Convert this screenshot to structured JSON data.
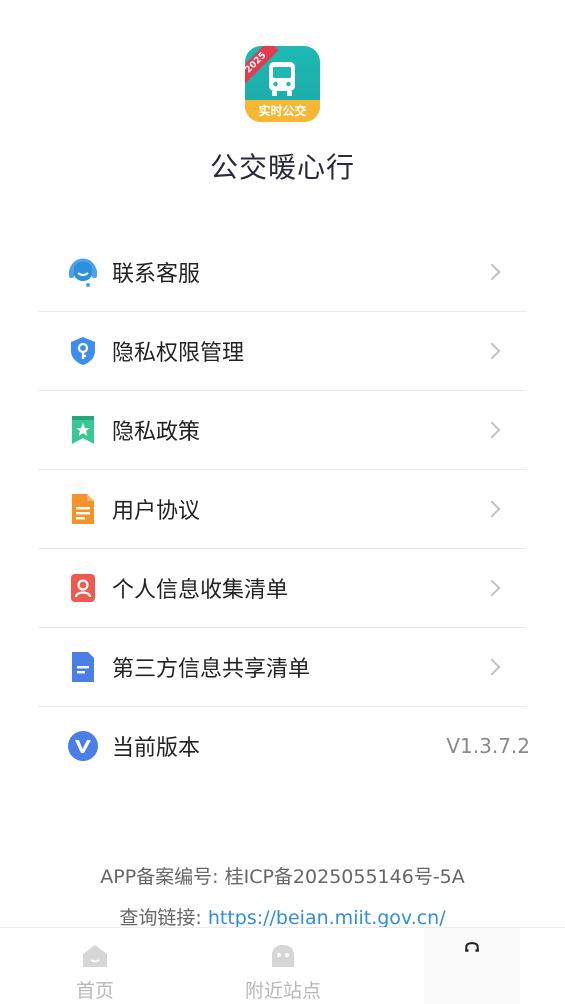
{
  "app": {
    "badge_year": "2025",
    "badge_text": "实时公交",
    "name": "公交暖心行"
  },
  "menu": {
    "items": [
      {
        "label": "联系客服",
        "icon": "customer-service-icon"
      },
      {
        "label": "隐私权限管理",
        "icon": "shield-key-icon"
      },
      {
        "label": "隐私政策",
        "icon": "bookmark-star-icon"
      },
      {
        "label": "用户协议",
        "icon": "document-icon"
      },
      {
        "label": "个人信息收集清单",
        "icon": "person-card-icon"
      },
      {
        "label": "第三方信息共享清单",
        "icon": "file-lines-icon"
      },
      {
        "label": "当前版本",
        "icon": "version-v-icon",
        "value": "V1.3.7.2"
      }
    ]
  },
  "footer": {
    "icp_label": "APP备案编号:",
    "icp_number": "桂ICP备2025055146号-5A",
    "query_label": "查询链接:",
    "query_link": "https://beian.miit.gov.cn/"
  },
  "tabbar": {
    "tabs": [
      {
        "label": "首页",
        "icon": "home-icon"
      },
      {
        "label": "附近站点",
        "icon": "nearby-icon"
      },
      {
        "label": "",
        "icon": "mine-icon"
      }
    ]
  },
  "colors": {
    "accent_link": "#2f8fdb",
    "logo_teal": "#1fb9b3",
    "logo_ribbon": "#e53b4f",
    "logo_banner": "#f7b733"
  }
}
